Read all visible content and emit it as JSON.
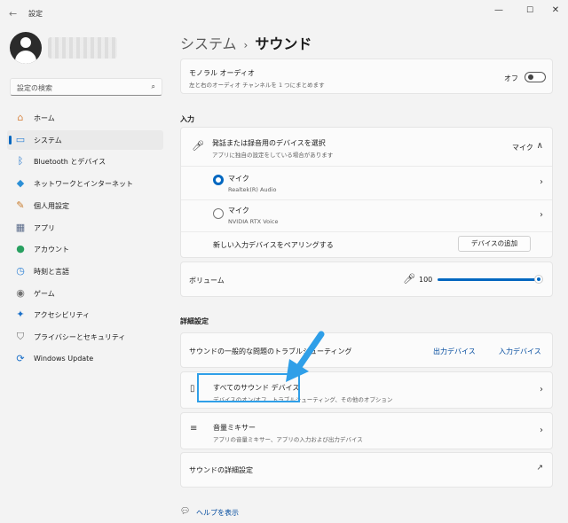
{
  "window": {
    "title": "設定",
    "back_icon": "←",
    "min_icon": "—",
    "max_icon": "☐",
    "close_icon": "✕"
  },
  "sidebar": {
    "search_placeholder": "設定の検索",
    "items": [
      {
        "label": "ホーム",
        "icon": "home-icon",
        "glyph": "⌂",
        "color": "#d98a4a"
      },
      {
        "label": "システム",
        "icon": "system-icon",
        "glyph": "▭",
        "color": "#2a7fd4",
        "active": true
      },
      {
        "label": "Bluetooth とデバイス",
        "icon": "bluetooth-icon",
        "glyph": "ᛒ",
        "color": "#1a6fc8"
      },
      {
        "label": "ネットワークとインターネット",
        "icon": "wifi-icon",
        "glyph": "◆",
        "color": "#2b8fd6"
      },
      {
        "label": "個人用設定",
        "icon": "brush-icon",
        "glyph": "✎",
        "color": "#c87a2a"
      },
      {
        "label": "アプリ",
        "icon": "apps-icon",
        "glyph": "▦",
        "color": "#5a6b8a"
      },
      {
        "label": "アカウント",
        "icon": "account-icon",
        "glyph": "●",
        "color": "#28a060"
      },
      {
        "label": "時刻と言語",
        "icon": "time-language-icon",
        "glyph": "◷",
        "color": "#2a7fd4"
      },
      {
        "label": "ゲーム",
        "icon": "game-icon",
        "glyph": "◉",
        "color": "#707070"
      },
      {
        "label": "アクセシビリティ",
        "icon": "accessibility-icon",
        "glyph": "✦",
        "color": "#1a6fc8"
      },
      {
        "label": "プライバシーとセキュリティ",
        "icon": "shield-icon",
        "glyph": "⛉",
        "color": "#707070"
      },
      {
        "label": "Windows Update",
        "icon": "update-icon",
        "glyph": "⟳",
        "color": "#1a6fc8"
      }
    ]
  },
  "main": {
    "breadcrumb_parent": "システム",
    "breadcrumb_sep": "›",
    "breadcrumb_current": "サウンド",
    "mono": {
      "title": "モノラル オーディオ",
      "subtitle": "左と右のオーディオ チャンネルを 1 つにまとめます",
      "toggle_label": "オフ",
      "toggle_on": false
    },
    "input_section": "入力",
    "input_select": {
      "title": "発話または録音用のデバイスを選択",
      "subtitle": "アプリに独自の設定をしている場合があります",
      "value": "マイク",
      "expand_icon": "∧"
    },
    "devices": [
      {
        "name": "マイク",
        "desc": "Realtek(R) Audio",
        "selected": true
      },
      {
        "name": "マイク",
        "desc": "NVIDIA RTX Voice",
        "selected": false
      }
    ],
    "pair": {
      "label": "新しい入力デバイスをペアリングする",
      "button": "デバイスの追加"
    },
    "volume": {
      "label": "ボリューム",
      "value": "100",
      "level": 1.0
    },
    "advanced_section": "詳細設定",
    "troubleshoot": {
      "label": "サウンドの一般的な問題のトラブルシューティング",
      "output": "出力デバイス",
      "input": "入力デバイス"
    },
    "all_devices": {
      "title": "すべてのサウンド デバイス",
      "subtitle": "デバイスのオン/オフ、トラブルシューティング、その他のオプション"
    },
    "mixer": {
      "title": "音量ミキサー",
      "subtitle": "アプリの音量ミキサー、アプリの入力および出力デバイス"
    },
    "more": {
      "label": "サウンドの詳細設定",
      "icon": "↗"
    },
    "help": "ヘルプを表示",
    "chevron": "›"
  },
  "colors": {
    "accent": "#0067c0",
    "annotation": "#2f9fe8"
  }
}
